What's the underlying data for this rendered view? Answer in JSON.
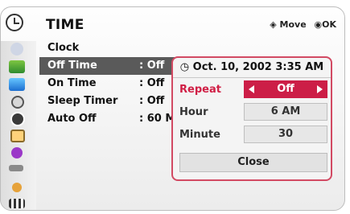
{
  "header": {
    "title": "TIME",
    "hint_move": "Move",
    "hint_ok": "OK"
  },
  "sidebar": {
    "items": [
      {
        "icon": "photo-icon"
      },
      {
        "icon": "picture-icon"
      },
      {
        "icon": "screen-icon"
      },
      {
        "icon": "target-icon"
      },
      {
        "icon": "clock-icon"
      },
      {
        "icon": "lock-icon"
      },
      {
        "icon": "info-icon"
      },
      {
        "icon": "input-icon"
      },
      {
        "icon": "usb-icon"
      },
      {
        "icon": "movie-icon"
      }
    ]
  },
  "menu": {
    "rows": [
      {
        "label": "Clock",
        "value": ""
      },
      {
        "label": "Off Time",
        "value": ": Off"
      },
      {
        "label": "On Time",
        "value": ": Off"
      },
      {
        "label": "Sleep Timer",
        "value": ": Off"
      },
      {
        "label": "Auto Off",
        "value": ": 60 M"
      }
    ]
  },
  "popup": {
    "datetime": "Oct. 10, 2002 3:35 AM",
    "repeat_label": "Repeat",
    "repeat_value": "Off",
    "hour_label": "Hour",
    "hour_value": "6 AM",
    "minute_label": "Minute",
    "minute_value": "30",
    "close_label": "Close"
  },
  "colors": {
    "accent": "#cc1e47",
    "selected_row": "#5a5a5a"
  }
}
